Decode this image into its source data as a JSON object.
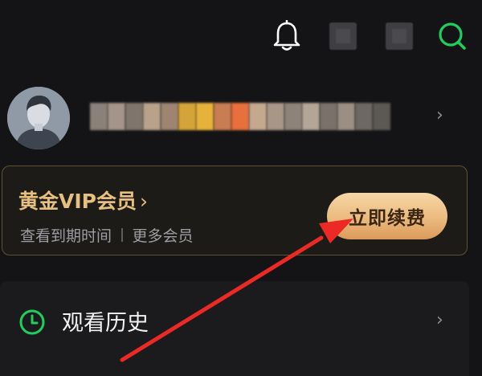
{
  "topbar": {
    "icons": [
      "bell-icon",
      "blurred-icon",
      "blurred-icon",
      "search-icon"
    ],
    "accent": "#1fcf5d"
  },
  "profile": {
    "avatar_icon": "user-silhouette-icon",
    "username_redacted": true
  },
  "vip": {
    "title": "黄金VIP会员",
    "title_chevron": "›",
    "link_expiry": "查看到期时间",
    "link_more": "更多会员",
    "renew_button": "立即续费",
    "gold": "#e7bf7e"
  },
  "history": {
    "icon": "clock-icon",
    "label": "观看历史"
  },
  "annotation": {
    "arrow_color": "#ec2a25"
  }
}
